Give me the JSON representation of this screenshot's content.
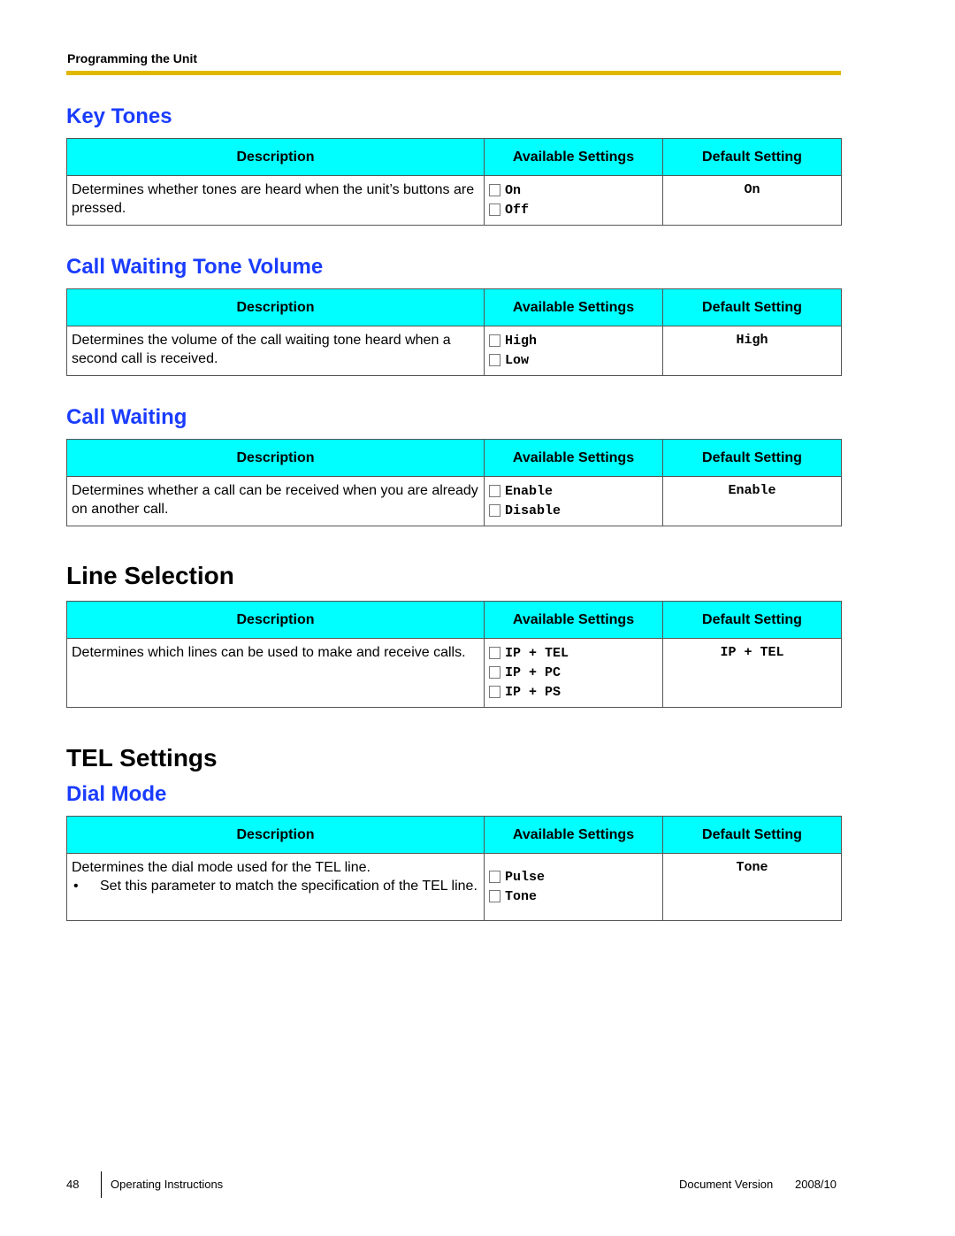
{
  "header": {
    "running_title": "Programming the Unit"
  },
  "columns": {
    "description": "Description",
    "available": "Available Settings",
    "default": "Default Setting"
  },
  "sections": [
    {
      "heading": "Key Tones",
      "description": "Determines whether tones are heard when the unit’s buttons are pressed.",
      "options": [
        "On",
        "Off"
      ],
      "default": "On"
    },
    {
      "heading": "Call Waiting Tone Volume",
      "description": "Determines the volume of the call waiting tone heard when a second call is received.",
      "options": [
        "High",
        "Low"
      ],
      "default": "High"
    },
    {
      "heading": "Call Waiting",
      "description": "Determines whether a call can be received when you are already on another call.",
      "options": [
        "Enable",
        "Disable"
      ],
      "default": "Enable"
    },
    {
      "heading": "Line Selection",
      "description": "Determines which lines can be used to make and receive calls.",
      "options": [
        "IP + TEL",
        "IP + PC",
        "IP + PS"
      ],
      "default": "IP + TEL"
    },
    {
      "chapter": "TEL Settings",
      "heading": "Dial Mode",
      "description": "Determines the dial mode used for the TEL line.",
      "bullet_char": "•",
      "bullet": "Set this parameter to match the specification of the TEL line.",
      "options": [
        "Pulse",
        "Tone"
      ],
      "default": "Tone"
    }
  ],
  "footer": {
    "page_number": "48",
    "doc_title": "Operating Instructions",
    "version_label": "Document Version",
    "version_value": "2008/10"
  }
}
